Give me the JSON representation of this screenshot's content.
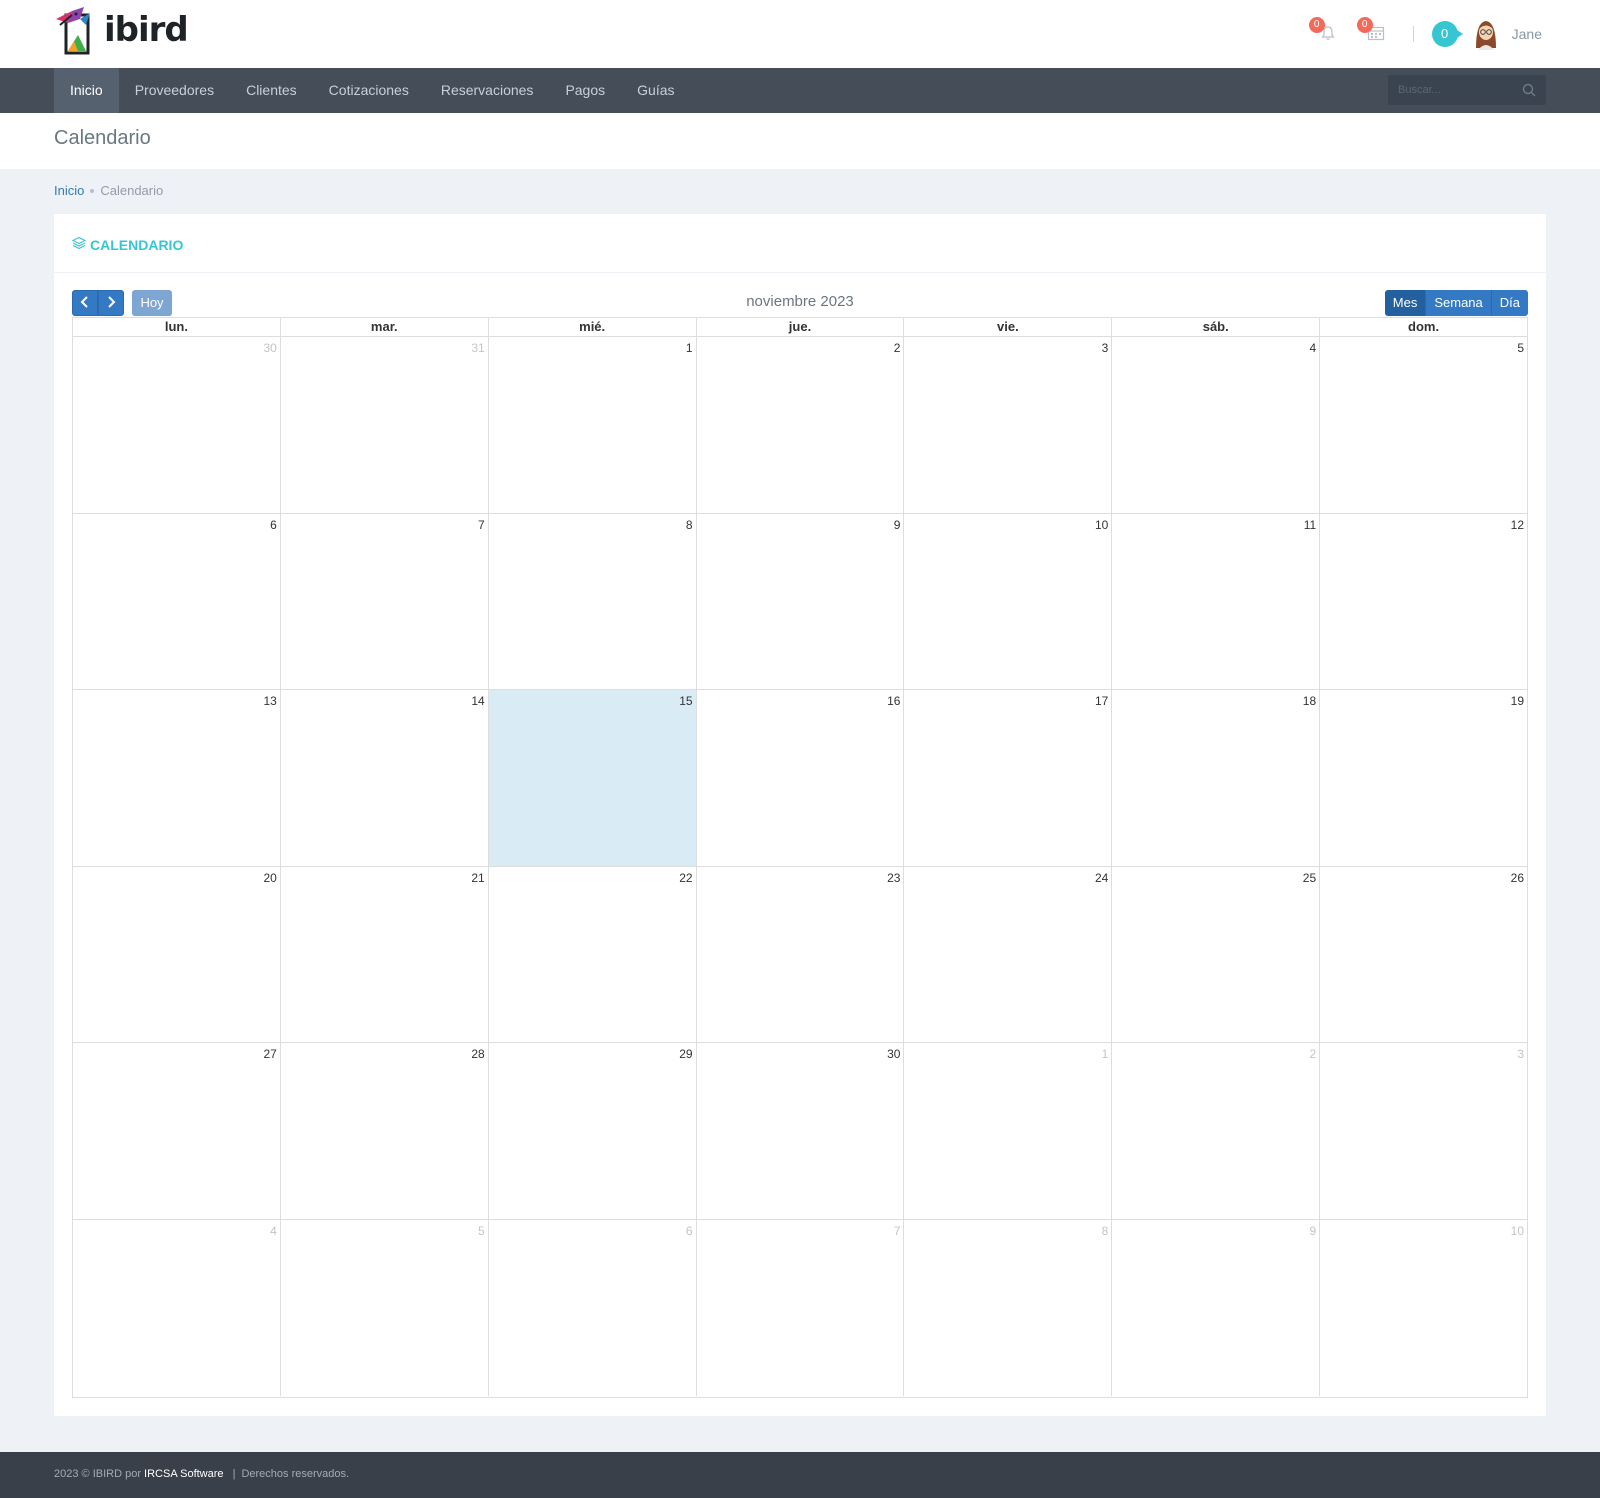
{
  "app": {
    "logo_text": "ibird"
  },
  "topbar": {
    "notifications_count": "0",
    "tasks_count": "0",
    "inbox_count": "0",
    "user_name": "Jane"
  },
  "nav": {
    "items": [
      {
        "label": "Inicio",
        "active": true
      },
      {
        "label": "Proveedores",
        "active": false
      },
      {
        "label": "Clientes",
        "active": false
      },
      {
        "label": "Cotizaciones",
        "active": false
      },
      {
        "label": "Reservaciones",
        "active": false
      },
      {
        "label": "Pagos",
        "active": false
      },
      {
        "label": "Guías",
        "active": false
      }
    ],
    "search_placeholder": "Buscar..."
  },
  "page": {
    "title": "Calendario"
  },
  "breadcrumb": {
    "home": "Inicio",
    "current": "Calendario"
  },
  "portlet": {
    "title": "CALENDARIO"
  },
  "calendar": {
    "title": "noviembre 2023",
    "today_label": "Hoy",
    "views": [
      "Mes",
      "Semana",
      "Día"
    ],
    "active_view": "Mes",
    "weekdays": [
      "lun.",
      "mar.",
      "mié.",
      "jue.",
      "vie.",
      "sáb.",
      "dom."
    ],
    "today_date": "15",
    "weeks": [
      [
        {
          "d": "30",
          "o": true
        },
        {
          "d": "31",
          "o": true
        },
        {
          "d": "1"
        },
        {
          "d": "2"
        },
        {
          "d": "3"
        },
        {
          "d": "4"
        },
        {
          "d": "5"
        }
      ],
      [
        {
          "d": "6"
        },
        {
          "d": "7"
        },
        {
          "d": "8"
        },
        {
          "d": "9"
        },
        {
          "d": "10"
        },
        {
          "d": "11"
        },
        {
          "d": "12"
        }
      ],
      [
        {
          "d": "13"
        },
        {
          "d": "14"
        },
        {
          "d": "15",
          "t": true
        },
        {
          "d": "16"
        },
        {
          "d": "17"
        },
        {
          "d": "18"
        },
        {
          "d": "19"
        }
      ],
      [
        {
          "d": "20"
        },
        {
          "d": "21"
        },
        {
          "d": "22"
        },
        {
          "d": "23"
        },
        {
          "d": "24"
        },
        {
          "d": "25"
        },
        {
          "d": "26"
        }
      ],
      [
        {
          "d": "27"
        },
        {
          "d": "28"
        },
        {
          "d": "29"
        },
        {
          "d": "30"
        },
        {
          "d": "1",
          "o": true
        },
        {
          "d": "2",
          "o": true
        },
        {
          "d": "3",
          "o": true
        }
      ],
      [
        {
          "d": "4",
          "o": true
        },
        {
          "d": "5",
          "o": true
        },
        {
          "d": "6",
          "o": true
        },
        {
          "d": "7",
          "o": true
        },
        {
          "d": "8",
          "o": true
        },
        {
          "d": "9",
          "o": true
        },
        {
          "d": "10",
          "o": true
        }
      ]
    ]
  },
  "footer": {
    "prefix": "2023 © IBIRD por",
    "brand": "IRCSA Software",
    "separator": "|",
    "suffix": "Derechos reservados."
  },
  "colors": {
    "accent": "#36c6d3",
    "primary_button": "#3379c4",
    "navbar": "#444d58",
    "today_highlight": "#d9ebf5",
    "badge": "#f36a5a"
  }
}
